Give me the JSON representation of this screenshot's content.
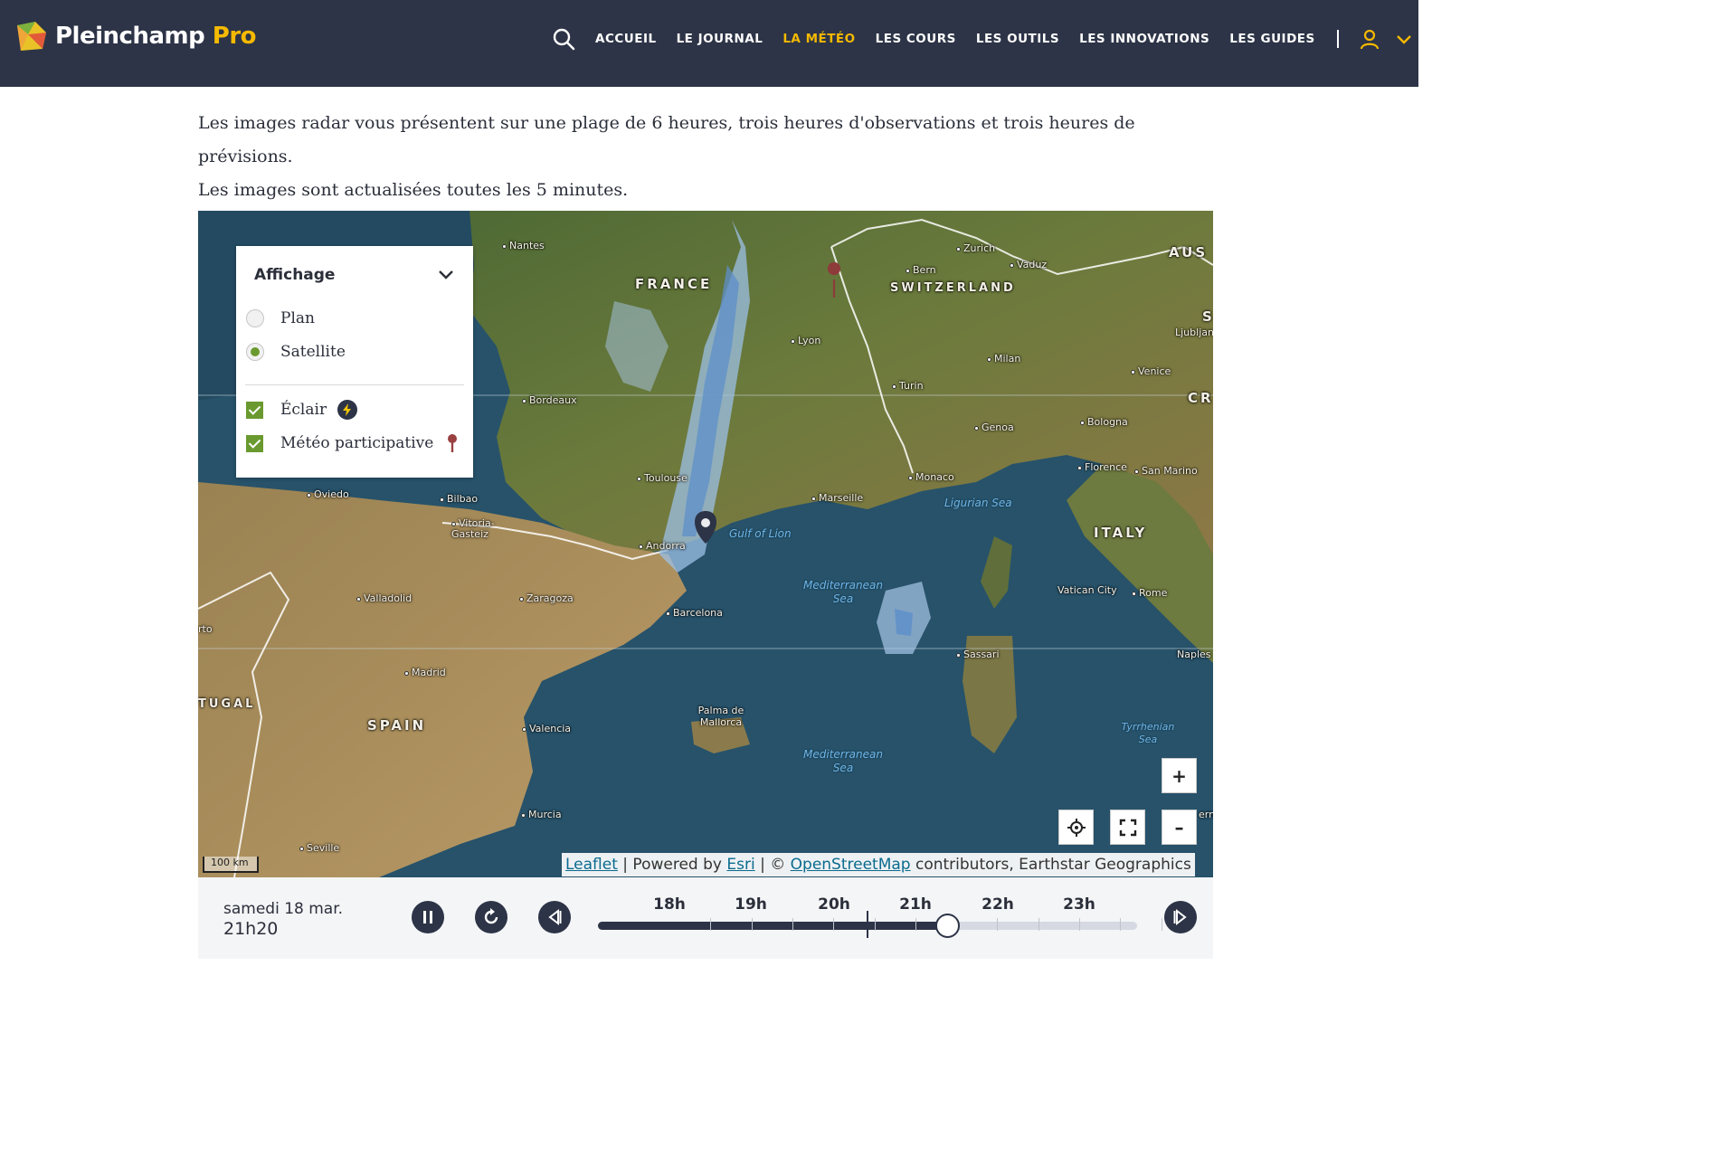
{
  "header": {
    "logo_text": "Pleinchamp",
    "logo_pro": "Pro",
    "nav": [
      {
        "label": "ACCUEIL",
        "active": false
      },
      {
        "label": "LE JOURNAL",
        "active": false
      },
      {
        "label": "LA MÉTÉO",
        "active": true
      },
      {
        "label": "LES COURS",
        "active": false
      },
      {
        "label": "LES OUTILS",
        "active": false
      },
      {
        "label": "LES INNOVATIONS",
        "active": false
      },
      {
        "label": "LES GUIDES",
        "active": false
      }
    ],
    "icons": [
      "search-icon",
      "user-icon",
      "chevron-down-icon"
    ],
    "colors": {
      "bar": "#2d3447",
      "accent": "#f5b900"
    }
  },
  "intro": {
    "line1": "Les images radar vous présentent sur une plage de 6 heures, trois heures d'observations et trois heures de prévisions.",
    "line2": "Les images sont actualisées toutes les 5 minutes."
  },
  "map": {
    "panel": {
      "title": "Affichage",
      "base_layers": [
        {
          "label": "Plan",
          "selected": false
        },
        {
          "label": "Satellite",
          "selected": true
        }
      ],
      "overlays": [
        {
          "label": "Éclair",
          "checked": true,
          "icon": "lightning-icon"
        },
        {
          "label": "Météo participative",
          "checked": true,
          "icon": "pin-icon"
        }
      ],
      "check_color": "#6a9a2f"
    },
    "labels": {
      "countries": [
        "FRANCE",
        "SWITZERLAND",
        "AUS",
        "SPAIN",
        "ITALY",
        "TUGAL",
        "CR",
        "S"
      ],
      "cities": [
        "Nantes",
        "Bordeaux",
        "Lyon",
        "Zurich",
        "Vaduz",
        "Bern",
        "Milan",
        "Turin",
        "Genoa",
        "Venice",
        "Bologna",
        "Florence",
        "San Marino",
        "Ljubljan",
        "Monaco",
        "Marseille",
        "Toulouse",
        "Andorra",
        "Barcelona",
        "Bilbao",
        "Vitoria-Gasteiz",
        "Oviedo",
        "Valladolid",
        "Zaragoza",
        "Madrid",
        "Valencia",
        "Palma de Mallorca",
        "Murcia",
        "Seville",
        "Sassari",
        "Vatican City",
        "Rome",
        "Naples",
        "rto",
        "ern"
      ],
      "seas": [
        "Ligurian Sea",
        "Gulf of Lion",
        "Mediterranean Sea",
        "Mediterranean Sea",
        "Tyrrhenian Sea"
      ]
    },
    "controls": {
      "zoom_in": "+",
      "zoom_out": "–"
    },
    "scale": "100 km",
    "attribution": {
      "leaflet": "Leaflet",
      "powered": " | Powered by ",
      "esri": "Esri",
      "sep": " | © ",
      "osm": "OpenStreetMap",
      "rest": " contributors, Earthstar Geographics"
    }
  },
  "timeline": {
    "day": "samedi 18 mar.",
    "time": "21h20",
    "hours": [
      "18h",
      "19h",
      "20h",
      "21h",
      "22h",
      "23h"
    ],
    "progress": 0.65,
    "now_fraction": 0.5,
    "buttons": [
      "pause-icon",
      "refresh-icon",
      "step-back-icon",
      "step-forward-icon"
    ]
  }
}
